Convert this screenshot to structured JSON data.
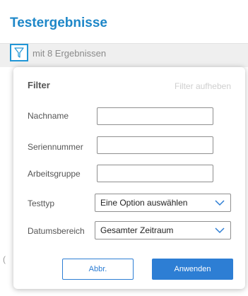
{
  "page": {
    "title": "Testergebnisse",
    "results_text": "mit 8 Ergebnissen"
  },
  "filter_panel": {
    "title": "Filter",
    "clear_label": "Filter aufheben",
    "fields": {
      "last_name": {
        "label": "Nachname",
        "value": ""
      },
      "serial_number": {
        "label": "Seriennummer",
        "value": ""
      },
      "work_group": {
        "label": "Arbeitsgruppe",
        "value": ""
      },
      "test_type": {
        "label": "Testtyp",
        "selected": "Eine Option auswählen"
      },
      "date_range": {
        "label": "Datumsbereich",
        "selected": "Gesamter Zeitraum"
      }
    },
    "cancel_label": "Abbr.",
    "apply_label": "Anwenden"
  },
  "colors": {
    "brand": "#1e87c8",
    "primary_button": "#2d7ed4",
    "filter_icon": "#2196d6"
  },
  "icons": {
    "filter": "funnel-icon",
    "dropdown": "chevron-down-icon"
  }
}
